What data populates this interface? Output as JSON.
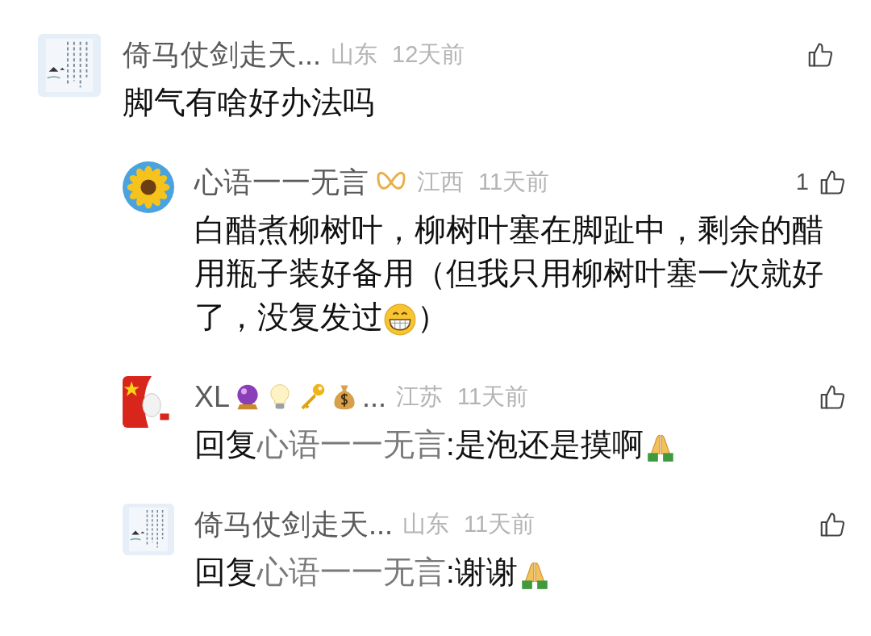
{
  "comments": [
    {
      "name": [
        {
          "kind": "text",
          "text": "倚马仗剑走天..."
        }
      ],
      "location": "山东",
      "time": "12天前",
      "body": [
        {
          "kind": "text",
          "text": "脚气有啥好办法吗"
        }
      ],
      "replies": [
        {
          "name": [
            {
              "kind": "text",
              "text": "心语一一无言"
            },
            {
              "kind": "badge"
            }
          ],
          "location": "江西",
          "time": "11天前",
          "likes": "1",
          "body": [
            {
              "kind": "text",
              "text": "白醋煮柳树叶，柳树叶塞在脚趾中，剩余的醋用瓶子装好备用（但我只用柳树叶塞一次就好了，没复发过"
            },
            {
              "kind": "grin"
            },
            {
              "kind": "text",
              "text": "）"
            }
          ]
        },
        {
          "name": [
            {
              "kind": "text",
              "text": "XL"
            },
            {
              "kind": "crystal-ball"
            },
            {
              "kind": "bulb"
            },
            {
              "kind": "key"
            },
            {
              "kind": "money-bag"
            },
            {
              "kind": "text",
              "text": "..."
            }
          ],
          "location": "江苏",
          "time": "11天前",
          "body": [
            {
              "kind": "text",
              "text": "回复"
            },
            {
              "kind": "mention",
              "text": "心语一一无言"
            },
            {
              "kind": "text",
              "text": ":是泡还是摸啊"
            },
            {
              "kind": "pray"
            }
          ]
        },
        {
          "name": [
            {
              "kind": "text",
              "text": "倚马仗剑走天..."
            }
          ],
          "location": "山东",
          "time": "11天前",
          "body": [
            {
              "kind": "text",
              "text": "回复"
            },
            {
              "kind": "mention",
              "text": "心语一一无言"
            },
            {
              "kind": "text",
              "text": ":谢谢"
            },
            {
              "kind": "pray"
            }
          ]
        }
      ]
    }
  ]
}
